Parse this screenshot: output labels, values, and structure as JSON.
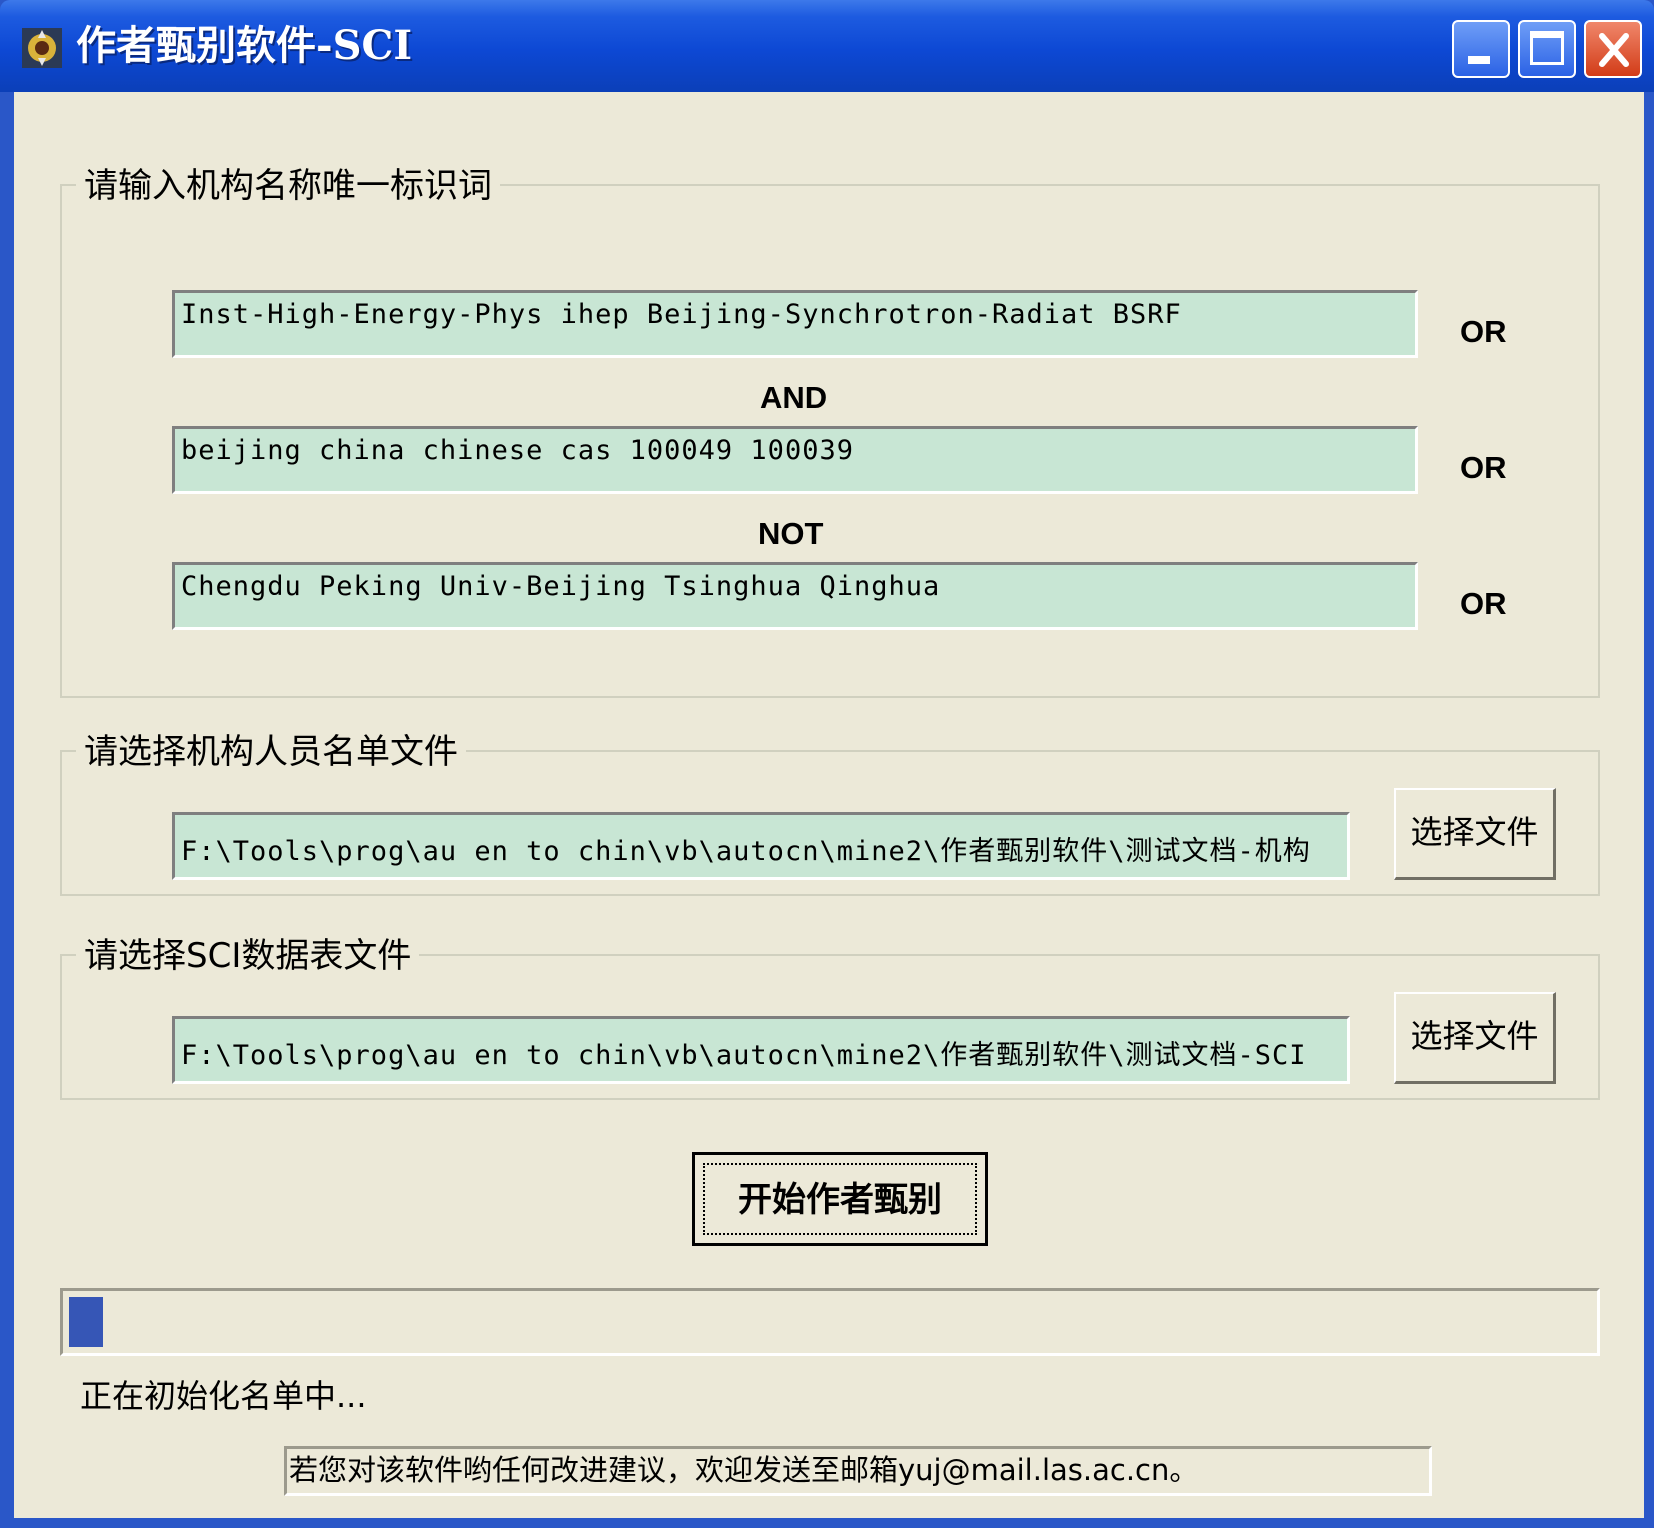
{
  "window": {
    "title": "作者甄别软件-SCI"
  },
  "identifiers_group": {
    "label": "请输入机构名称唯一标识词",
    "fields": [
      {
        "value": "Inst-High-Energy-Phys ihep Beijing-Synchrotron-Radiat BSRF",
        "suffix": "OR"
      },
      {
        "value": "beijing china chinese cas 100049 100039",
        "suffix": "OR"
      },
      {
        "value": "Chengdu Peking Univ-Beijing Tsinghua Qinghua",
        "suffix": "OR"
      }
    ],
    "operators": [
      "AND",
      "NOT"
    ]
  },
  "staff_list_group": {
    "label": "请选择机构人员名单文件",
    "path": "F:\\Tools\\prog\\au en to chin\\vb\\autocn\\mine2\\作者甄别软件\\测试文档-机构",
    "button_label": "选择文件"
  },
  "sci_table_group": {
    "label": "请选择SCI数据表文件",
    "path": "F:\\Tools\\prog\\au en to chin\\vb\\autocn\\mine2\\作者甄别软件\\测试文档-SCI",
    "button_label": "选择文件"
  },
  "start_button_label": "开始作者甄别",
  "progress": {
    "fraction": 0.02
  },
  "status": "正在初始化名单中...",
  "feedback": "若您对该软件哟任何改进建议，欢迎发送至邮箱yuj@mail.las.ac.cn。",
  "colors": {
    "field_background": "#c8e6d4",
    "progress_fill": "#3656b6",
    "titlebar": "#0d48d4"
  }
}
